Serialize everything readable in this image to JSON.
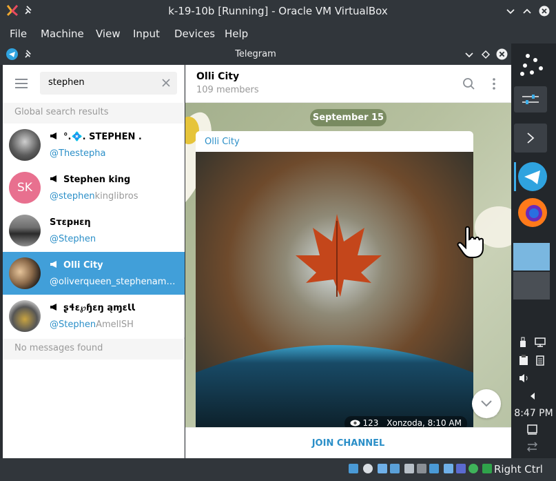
{
  "vbox": {
    "title": "k-19-10b [Running] - Oracle VM VirtualBox"
  },
  "menu": {
    "items": [
      "File",
      "Machine",
      "View",
      "Input",
      "Devices",
      "Help"
    ]
  },
  "telegram": {
    "title": "Telegram",
    "search_value": "stephen",
    "global_label": "Global search results",
    "results": [
      {
        "name": "°.💠. STEPHEN .",
        "user_hl": "@Thestepha",
        "user_rest": "",
        "channel": true
      },
      {
        "name": "Stephen king",
        "user_hl": "@stephen",
        "user_rest": "kinglibros",
        "channel": true,
        "initials": "SK"
      },
      {
        "name": "Sτεpнεη",
        "user_hl": "@Stephen",
        "user_rest": "",
        "channel": false
      },
      {
        "name": "Olli City",
        "user_hl": "@oliverqueen_stephenamel_...",
        "user_rest": "",
        "channel": true,
        "selected": true
      },
      {
        "name": "ʂɬɛ℘ɧɛŋ ąɱɛƖƖ",
        "user_hl": "@Stephen",
        "user_rest": "AmellSH",
        "channel": true
      }
    ],
    "no_messages": "No messages found",
    "chat": {
      "name": "Olli City",
      "members": "109 members",
      "date": "September 15",
      "from": "Olli City",
      "views": "123",
      "author_time": "Xonzoda, 8:10 AM",
      "join": "JOIN CHANNEL"
    }
  },
  "tray": {
    "time": "8:47 PM"
  },
  "status": {
    "host_key": "Right Ctrl"
  },
  "colors": {
    "accent": "#419fd9",
    "link": "#2b8fc8",
    "avatar_sk": "#e8708f"
  }
}
